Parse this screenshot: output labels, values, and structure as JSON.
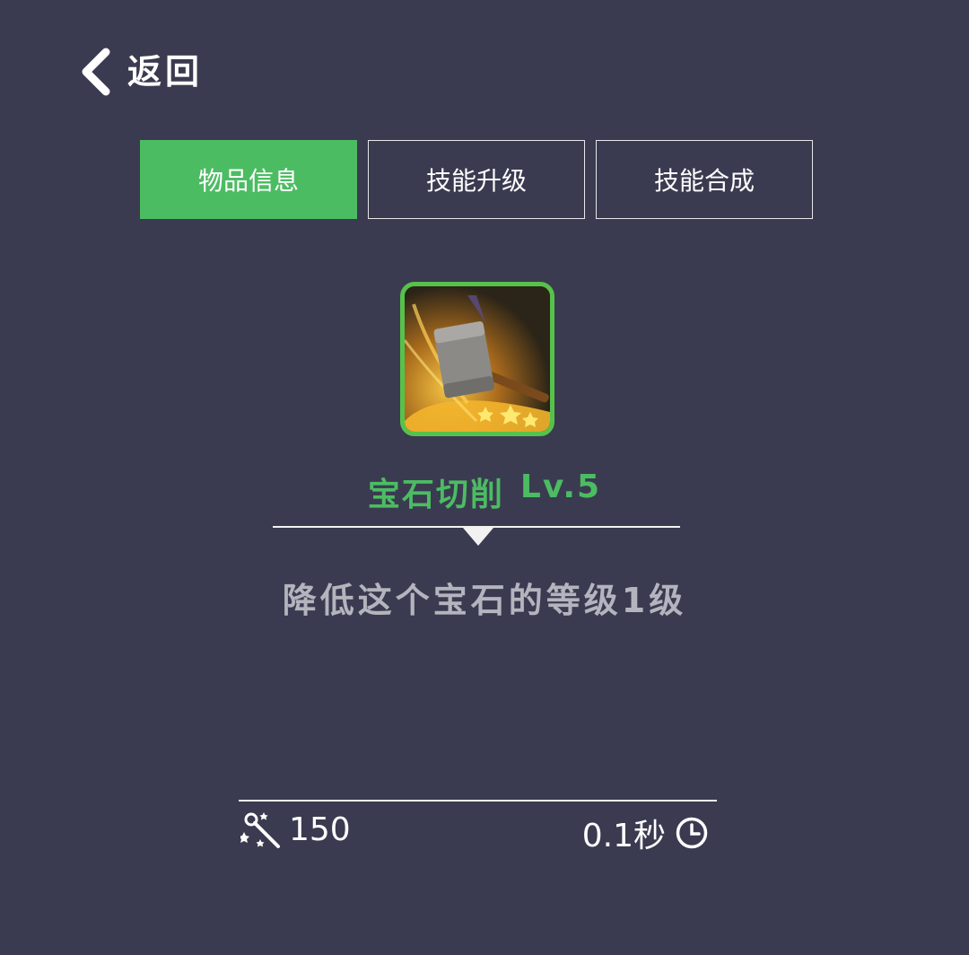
{
  "header": {
    "back_label": "返回"
  },
  "tabs": [
    {
      "label": "物品信息",
      "active": true
    },
    {
      "label": "技能升级",
      "active": false
    },
    {
      "label": "技能合成",
      "active": false
    }
  ],
  "skill": {
    "icon": "hammer-skill-icon",
    "name": "宝石切削",
    "level": "Lv.5",
    "description": "降低这个宝石的等级1级",
    "cost_value": "150",
    "cost_icon": "magic-wand-icon",
    "cooldown_value": "0.1秒",
    "cooldown_icon": "clock-icon"
  },
  "colors": {
    "background": "#3a3b50",
    "accent": "#4cbc63",
    "description_text": "#b3b4bd"
  }
}
